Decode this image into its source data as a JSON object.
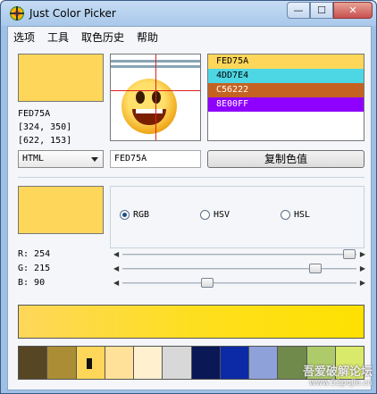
{
  "window": {
    "title": "Just Color Picker"
  },
  "menu": [
    "选项",
    "工具",
    "取色历史",
    "帮助"
  ],
  "current_color": {
    "hex": "FED75A",
    "coords_screen": "[324, 350]",
    "coords_window": "[622, 153]"
  },
  "history": [
    {
      "label": "FED75A",
      "color": "#fed75a",
      "text": "#000000"
    },
    {
      "label": "4DD7E4",
      "color": "#4dd7e4",
      "text": "#000000"
    },
    {
      "label": "C56222",
      "color": "#c56222",
      "text": "#ffffff"
    },
    {
      "label": "8E00FF",
      "color": "#8e00ff",
      "text": "#ffffff"
    }
  ],
  "format_select": {
    "value": "HTML"
  },
  "hex_field": {
    "value": "FED75A"
  },
  "copy_button": {
    "label": "复制色值"
  },
  "color_models": [
    {
      "label": "RGB",
      "checked": true
    },
    {
      "label": "HSV",
      "checked": false
    },
    {
      "label": "HSL",
      "checked": false
    }
  ],
  "sliders": [
    {
      "label": "R: 254",
      "value": 254,
      "max": 255
    },
    {
      "label": "G: 215",
      "value": 215,
      "max": 255
    },
    {
      "label": "B: 90",
      "value": 90,
      "max": 255
    }
  ],
  "palette": [
    "#574623",
    "#ab8d36",
    "#fed75a",
    "#ffe199",
    "#fff0cf",
    "#d8d8d8",
    "#0b1856",
    "#0c2aa6",
    "#8ea1d9",
    "#6f8a4a",
    "#aecb6a",
    "#d9e96a"
  ],
  "watermark": {
    "line1": "吾爱破解论坛",
    "line2": "www.52pojie.cn"
  }
}
